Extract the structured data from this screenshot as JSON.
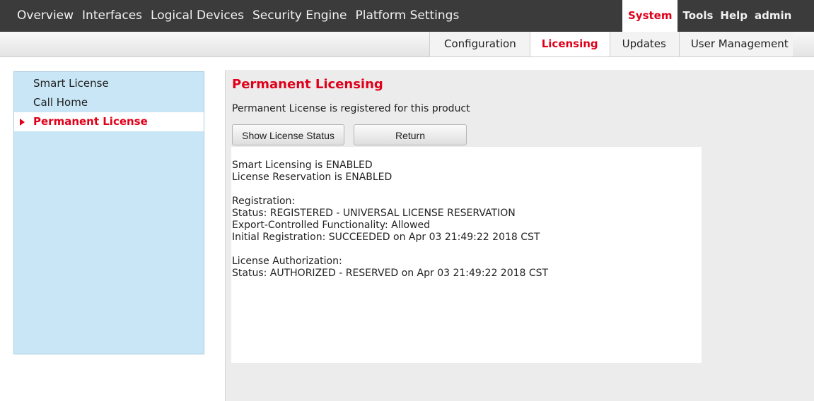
{
  "topnav": {
    "left_items": [
      "Overview",
      "Interfaces",
      "Logical Devices",
      "Security Engine",
      "Platform Settings"
    ],
    "right_items": [
      "System",
      "Tools",
      "Help",
      "admin"
    ],
    "active": "System"
  },
  "subnav": {
    "tabs": [
      "Configuration",
      "Licensing",
      "Updates",
      "User Management"
    ],
    "active": "Licensing"
  },
  "sidebar": {
    "items": [
      "Smart License",
      "Call Home",
      "Permanent License"
    ],
    "active": "Permanent License"
  },
  "panel": {
    "title": "Permanent Licensing",
    "subtitle": "Permanent License is registered for this product",
    "buttons": {
      "show_status": "Show License Status",
      "return": "Return"
    },
    "status_lines": [
      "Smart Licensing is ENABLED",
      "License Reservation is ENABLED",
      "",
      "Registration:",
      "Status: REGISTERED - UNIVERSAL LICENSE RESERVATION",
      "Export-Controlled Functionality: Allowed",
      "Initial Registration: SUCCEEDED on Apr 03 21:49:22 2018 CST",
      "",
      "License Authorization:",
      "Status: AUTHORIZED - RESERVED on Apr 03 21:49:22 2018 CST"
    ]
  },
  "colors": {
    "accent": "#e0001a",
    "topbar": "#3b3b3b",
    "sidebar_bg": "#c8e6f5",
    "panel_bg": "#ececec"
  }
}
